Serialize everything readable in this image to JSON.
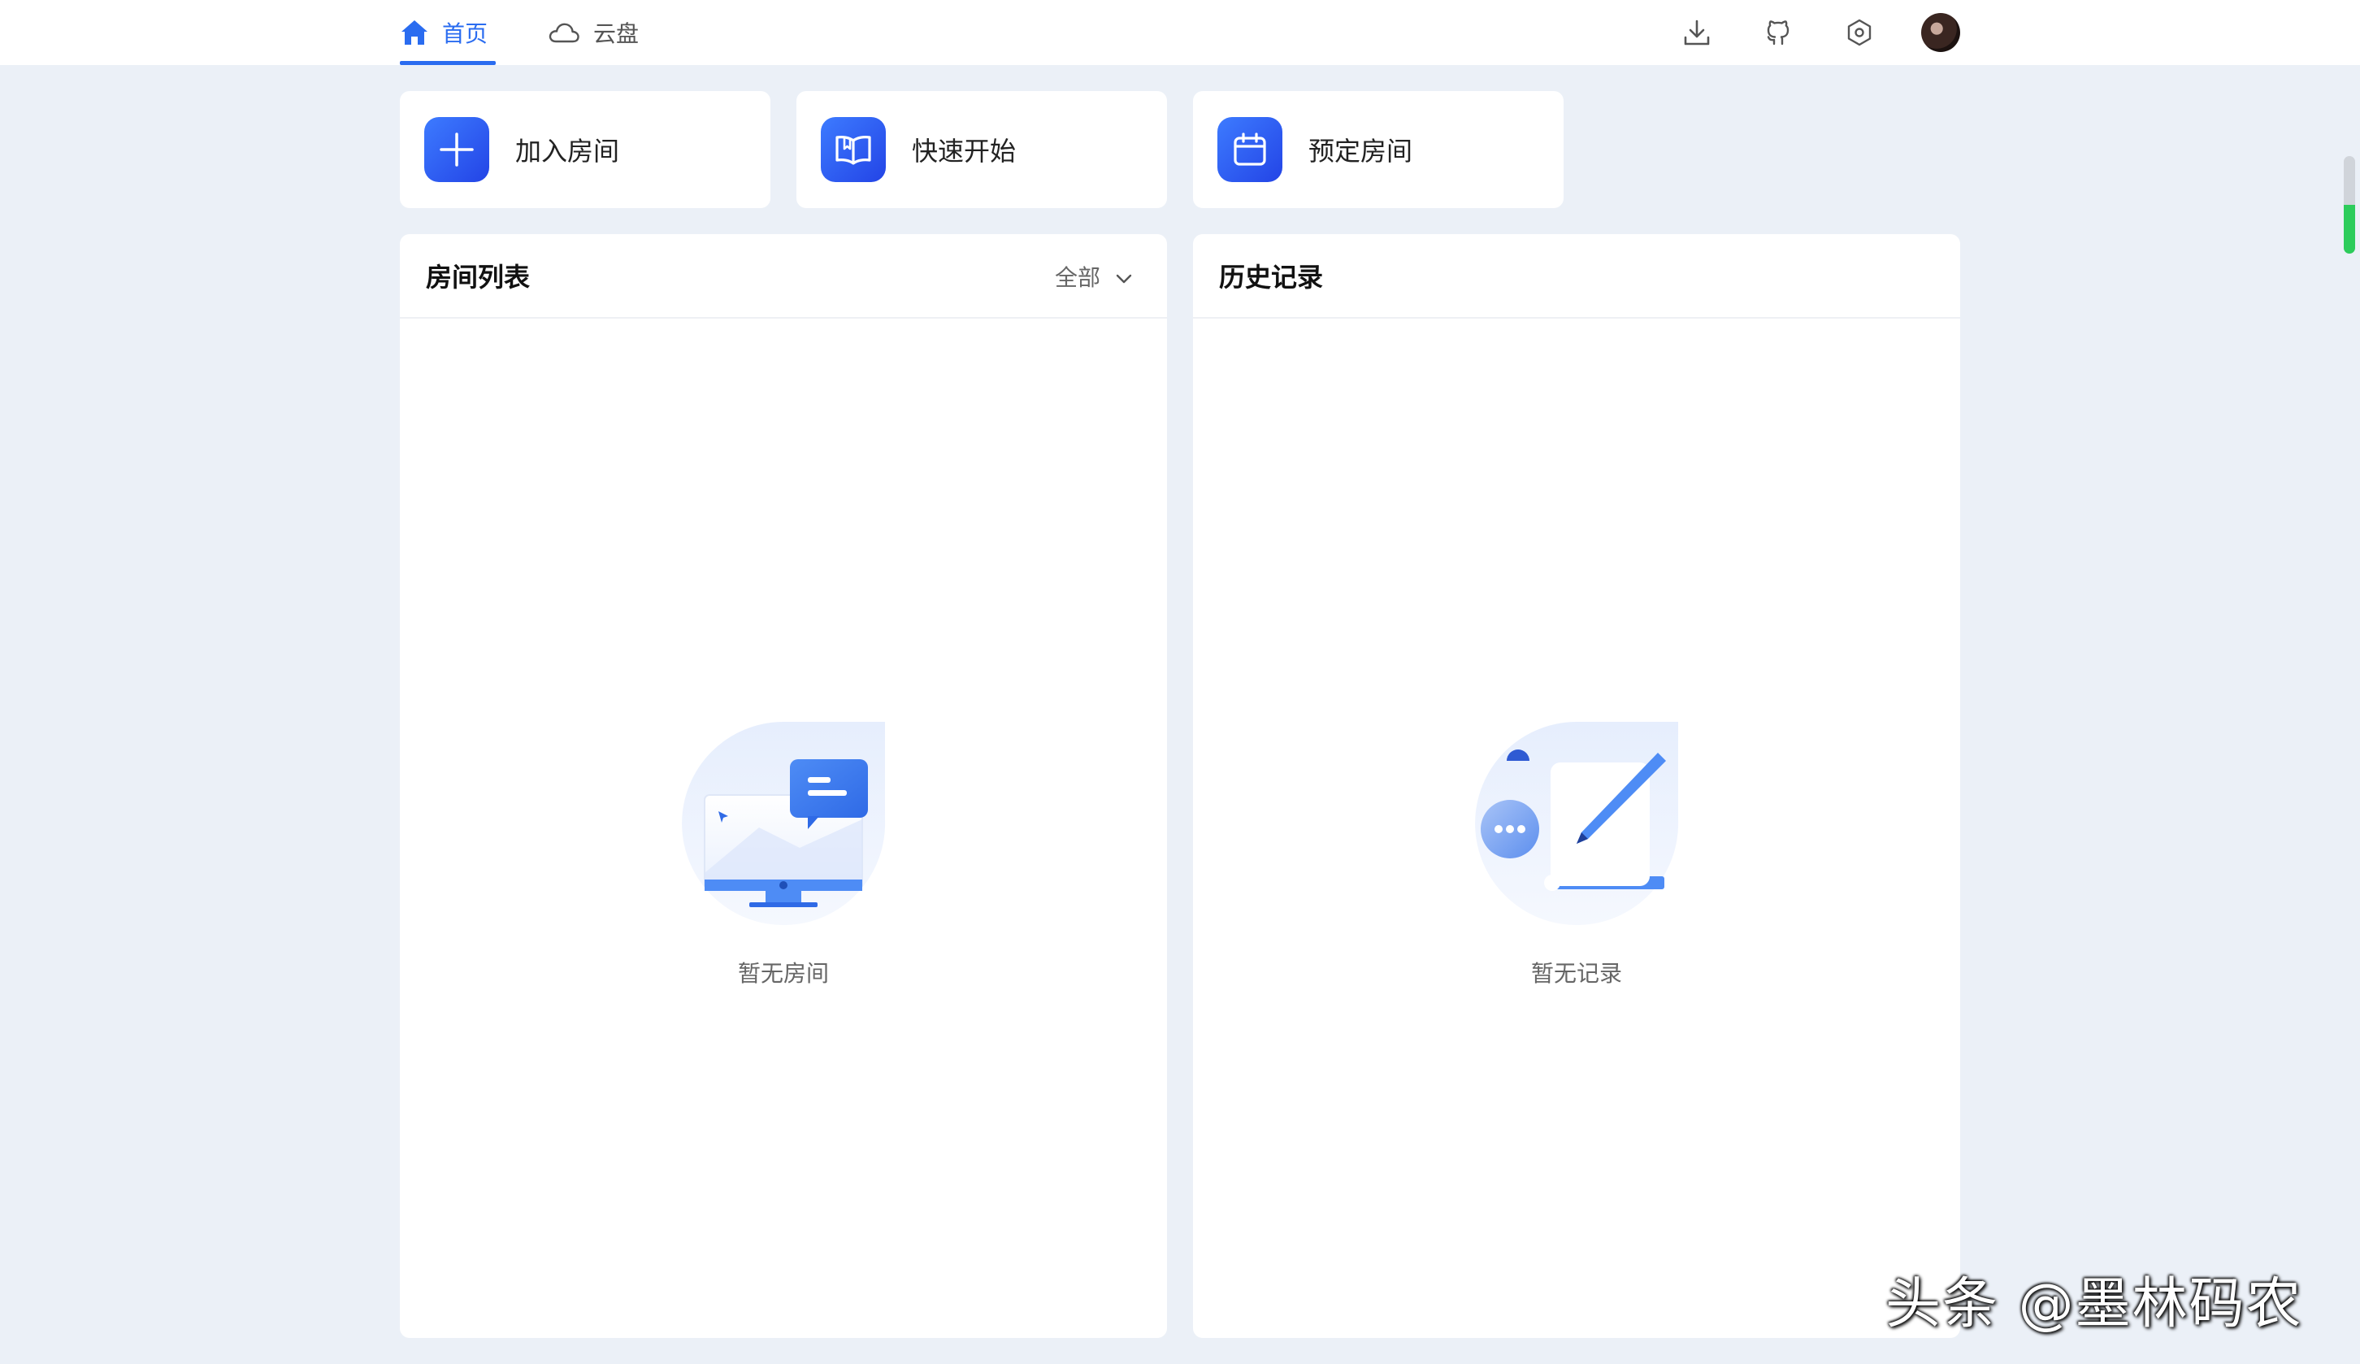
{
  "nav": {
    "tabs": [
      {
        "label": "首页",
        "icon": "home-icon",
        "active": true
      },
      {
        "label": "云盘",
        "icon": "cloud-icon",
        "active": false
      }
    ],
    "right_icons": [
      "download-icon",
      "github-icon",
      "settings-icon",
      "avatar"
    ]
  },
  "quick_actions": [
    {
      "label": "加入房间",
      "icon": "plus-icon"
    },
    {
      "label": "快速开始",
      "icon": "book-icon"
    },
    {
      "label": "预定房间",
      "icon": "calendar-icon"
    }
  ],
  "room_list": {
    "title": "房间列表",
    "filter_value": "全部",
    "empty_text": "暂无房间"
  },
  "history": {
    "title": "历史记录",
    "empty_text": "暂无记录"
  },
  "watermark": "头条 @墨林码农",
  "colors": {
    "accent": "#2a6cf0",
    "background": "#ebf0f7",
    "icon_gradient_start": "#3d7bff",
    "icon_gradient_end": "#2344e6"
  }
}
